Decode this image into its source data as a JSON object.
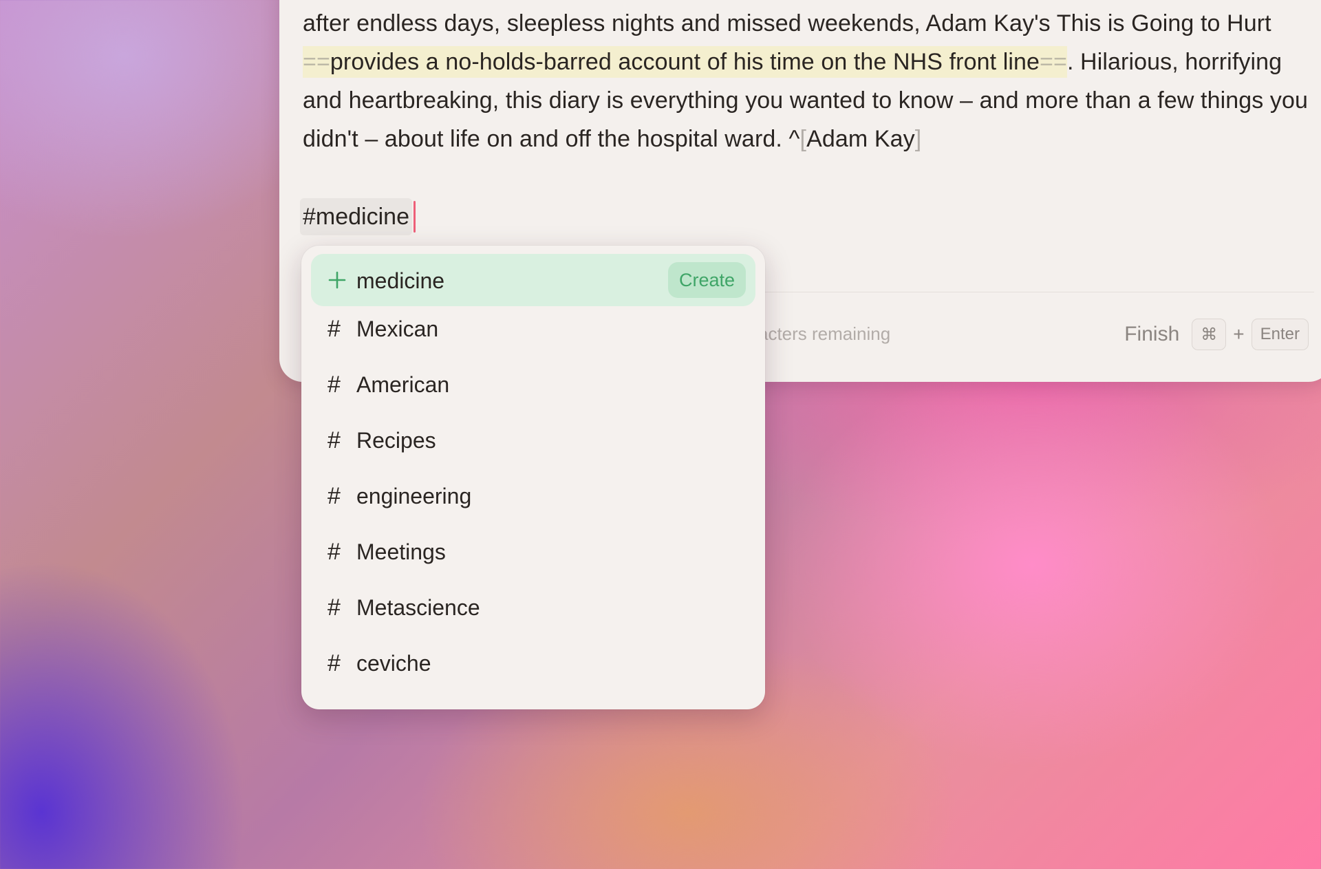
{
  "note": {
    "text_line1_pre": "after endless days, sleepless nights and missed weekends, Adam Kay's This is Going to Hurt",
    "highlight_open": "==",
    "highlight_text": "provides a no-holds-barred account of his time on the NHS front line",
    "highlight_close": "==",
    "text_after_highlight": ". Hilarious, horrifying and heartbreaking, this diary is everything you wanted to know – and more than a few things you didn't – about life on and off the hospital ward. ^",
    "cite_open": "[",
    "cite_text": "Adam Kay",
    "cite_close": "]",
    "tag_input": "#medicine"
  },
  "footer": {
    "remaining_hint": "acters remaining",
    "finish_label": "Finish",
    "key_cmd": "⌘",
    "key_plus": "+",
    "key_enter": "Enter"
  },
  "tag_menu": {
    "create": {
      "icon": "plus-icon",
      "label": "medicine",
      "button": "Create"
    },
    "hash_glyph": "#",
    "items": [
      {
        "label": "Mexican"
      },
      {
        "label": "American"
      },
      {
        "label": "Recipes"
      },
      {
        "label": "engineering"
      },
      {
        "label": "Meetings"
      },
      {
        "label": "Metascience"
      },
      {
        "label": "ceviche"
      }
    ]
  },
  "colors": {
    "highlight": "#f4efcf",
    "caret": "#ee5f79",
    "create_bg": "#d9f0e0",
    "create_accent": "#3fa567"
  }
}
